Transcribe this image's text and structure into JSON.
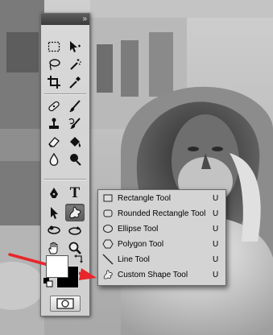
{
  "toolbox": {
    "collapse_icon": "»",
    "text_tool_glyph": "T"
  },
  "flyout": {
    "items": [
      {
        "label": "Rectangle Tool",
        "shortcut": "U",
        "icon": "rectangle-icon"
      },
      {
        "label": "Rounded Rectangle Tool",
        "shortcut": "U",
        "icon": "rounded-rectangle-icon"
      },
      {
        "label": "Ellipse Tool",
        "shortcut": "U",
        "icon": "ellipse-icon"
      },
      {
        "label": "Polygon Tool",
        "shortcut": "U",
        "icon": "polygon-icon"
      },
      {
        "label": "Line Tool",
        "shortcut": "U",
        "icon": "line-icon"
      },
      {
        "label": "Custom Shape Tool",
        "shortcut": "U",
        "icon": "custom-shape-icon"
      }
    ]
  },
  "colors": {
    "foreground": "#ffffff",
    "background": "#000000",
    "annotation_arrow": "#e8262a"
  }
}
